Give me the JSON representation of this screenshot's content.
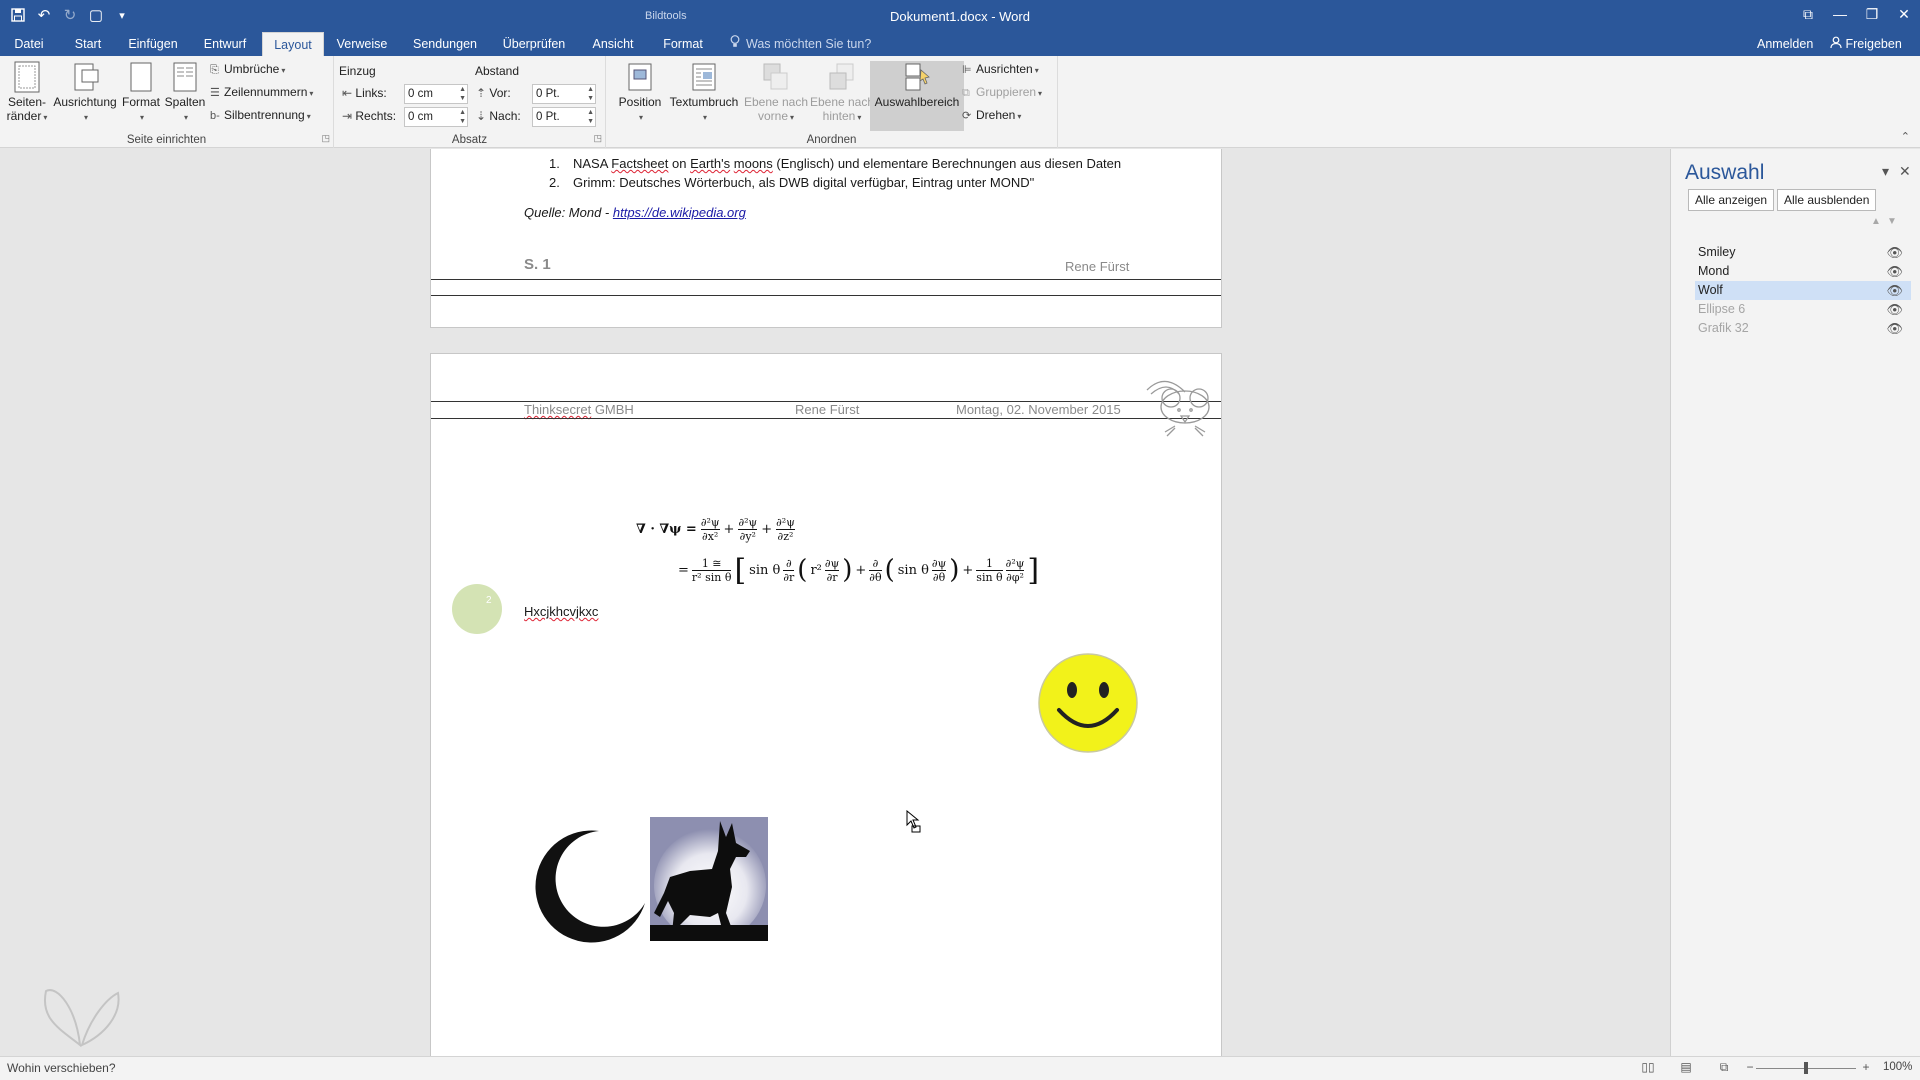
{
  "window": {
    "context_tab_group": "Bildtools",
    "title": "Dokument1.docx - Word",
    "controls": {
      "ribbon_display": "⧉",
      "minimize": "—",
      "restore": "❐",
      "close": "✕"
    }
  },
  "quick_access": {
    "save_icon": "💾",
    "undo_icon": "↶",
    "redo_icon": "↻",
    "touch_icon": "▢",
    "customize_icon": "▾"
  },
  "tabs": [
    {
      "label": "Datei"
    },
    {
      "label": "Start"
    },
    {
      "label": "Einfügen"
    },
    {
      "label": "Entwurf"
    },
    {
      "label": "Layout"
    },
    {
      "label": "Verweise"
    },
    {
      "label": "Sendungen"
    },
    {
      "label": "Überprüfen"
    },
    {
      "label": "Ansicht"
    },
    {
      "label": "Format"
    }
  ],
  "active_tab": "Layout",
  "tell_me": {
    "icon": "lightbulb-icon",
    "placeholder": "Was möchten Sie tun?"
  },
  "account": {
    "signin": "Anmelden",
    "share": "Freigeben"
  },
  "ribbon": {
    "seite_einrichten": {
      "label": "Seite einrichten",
      "seitenraender_line1": "Seiten-",
      "seitenraender_line2": "ränder",
      "ausrichtung": "Ausrichtung",
      "format": "Format",
      "spalten": "Spalten",
      "umbrueche": "Umbrüche",
      "zeilennummern": "Zeilennummern",
      "silbentrennung": "Silbentrennung"
    },
    "absatz": {
      "label": "Absatz",
      "einzug": "Einzug",
      "abstand": "Abstand",
      "links_label": "Links:",
      "links_value": "0 cm",
      "rechts_label": "Rechts:",
      "rechts_value": "0 cm",
      "vor_label": "Vor:",
      "vor_value": "0 Pt.",
      "nach_label": "Nach:",
      "nach_value": "0 Pt."
    },
    "anordnen": {
      "label": "Anordnen",
      "position": "Position",
      "textumbruch": "Textumbruch",
      "ebene_vorne_line1": "Ebene nach",
      "ebene_vorne_line2": "vorne",
      "ebene_hinten_line1": "Ebene nach",
      "ebene_hinten_line2": "hinten",
      "auswahlbereich": "Auswahlbereich",
      "ausrichten": "Ausrichten",
      "gruppieren": "Gruppieren",
      "drehen": "Drehen"
    }
  },
  "document": {
    "list_items": [
      {
        "num": "1.",
        "pre": "NASA ",
        "w1": "Factsheet",
        "mid1": " on ",
        "w2": "Earth's",
        "mid2": " ",
        "w3": "moons",
        "post": " (Englisch) und elementare Berechnungen aus diesen Daten"
      },
      {
        "num": "2.",
        "text": "Grimm: Deutsches Wörterbuch, als DWB digital verfügbar, Eintrag unter MOND\""
      }
    ],
    "source_prefix": "Quelle: Mond - ",
    "source_link": "https://de.wikipedia.org",
    "footer_page": "S. 1",
    "footer_author": "Rene Fürst",
    "header_company_a": "Thinksecret",
    "header_company_b": " GMBH",
    "header_author": "Rene Fürst",
    "header_date": "Montag, 02. November 2015",
    "equation": {
      "line1_lhs": "∇ · ∇ψ =",
      "line2_lhs": "=",
      "frac_top_1": "∂²ψ",
      "frac_bot_1": "∂x²",
      "frac_top_2": "∂²ψ",
      "frac_bot_2": "∂y²",
      "frac_top_3": "∂²ψ",
      "frac_bot_3": "∂z²",
      "l2_frac_top": "1 ≅",
      "l2_frac_bot": "r² sin θ",
      "l2_sin": "sin θ",
      "l2_d_top": "∂",
      "l2_d_bot": "∂r",
      "l2_r2": "r²",
      "l2_dpsi_top": "∂ψ",
      "l2_dpsi_bot": "∂r",
      "l2_dth_top": "∂",
      "l2_dth_bot": "∂θ",
      "l2_sin2": "sin θ",
      "l2_dpsi2_top": "∂ψ",
      "l2_dpsi2_bot": "∂θ",
      "l2_last_top": "1",
      "l2_last_bot": "sin θ",
      "l2_final_top": "∂²ψ",
      "l2_final_bot": "∂φ²",
      "plus": "+"
    },
    "circle_label": "2",
    "body_text": "Hxcjkhcvjkxc"
  },
  "selection_pane": {
    "title": "Auswahl",
    "show_all": "Alle anzeigen",
    "hide_all": "Alle ausblenden",
    "items": [
      {
        "name": "Smiley",
        "visible": true,
        "selected": false
      },
      {
        "name": "Mond",
        "visible": true,
        "selected": false
      },
      {
        "name": "Wolf",
        "visible": true,
        "selected": true
      },
      {
        "name": "Ellipse 6",
        "visible": false,
        "selected": false
      },
      {
        "name": "Grafik 32",
        "visible": false,
        "selected": false
      }
    ]
  },
  "status": {
    "text": "Wohin verschieben?",
    "zoom": "100%",
    "zoom_minus": "−",
    "zoom_plus": "+"
  },
  "colors": {
    "accent": "#2b579a",
    "smiley": "#f2f21a",
    "selection": "#cfe0f6",
    "circle": "#d4e3b4"
  }
}
